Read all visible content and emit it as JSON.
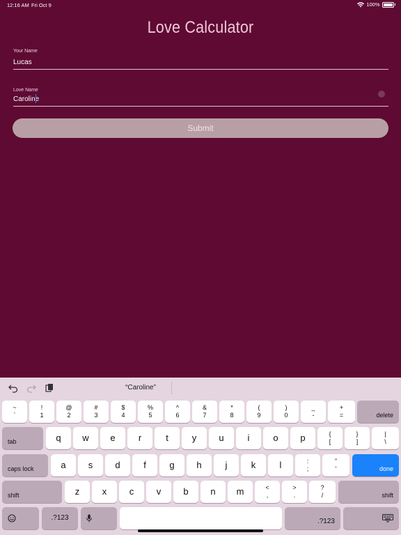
{
  "status_bar": {
    "time": "12:16 AM",
    "date": "Fri Oct 9",
    "battery": "100%"
  },
  "app": {
    "title": "Love Calculator",
    "your_name": {
      "label": "Your Name",
      "value": "Lucas"
    },
    "love_name": {
      "label": "Love Name",
      "value": "Caroline"
    },
    "submit_label": "Submit"
  },
  "keyboard": {
    "prediction": "“Caroline”",
    "number_row": [
      {
        "top": "~",
        "bottom": "`"
      },
      {
        "top": "!",
        "bottom": "1"
      },
      {
        "top": "@",
        "bottom": "2"
      },
      {
        "top": "#",
        "bottom": "3"
      },
      {
        "top": "$",
        "bottom": "4"
      },
      {
        "top": "%",
        "bottom": "5"
      },
      {
        "top": "^",
        "bottom": "6"
      },
      {
        "top": "&",
        "bottom": "7"
      },
      {
        "top": "*",
        "bottom": "8"
      },
      {
        "top": "(",
        "bottom": "9"
      },
      {
        "top": ")",
        "bottom": "0"
      },
      {
        "top": "_",
        "bottom": "-"
      },
      {
        "top": "+",
        "bottom": "="
      }
    ],
    "delete_label": "delete",
    "tab_label": "tab",
    "row_q": [
      "q",
      "w",
      "e",
      "r",
      "t",
      "y",
      "u",
      "i",
      "o",
      "p"
    ],
    "row_q_symbols": [
      {
        "top": "{",
        "bottom": "["
      },
      {
        "top": "}",
        "bottom": "]"
      },
      {
        "top": "|",
        "bottom": "\\"
      }
    ],
    "caps_label": "caps lock",
    "row_a": [
      "a",
      "s",
      "d",
      "f",
      "g",
      "h",
      "j",
      "k",
      "l"
    ],
    "row_a_symbols": [
      {
        "top": ":",
        "bottom": ";"
      },
      {
        "top": "”",
        "bottom": "’"
      }
    ],
    "done_label": "done",
    "shift_label": "shift",
    "row_z": [
      "z",
      "x",
      "c",
      "v",
      "b",
      "n",
      "m"
    ],
    "row_z_symbols": [
      {
        "top": "<",
        "bottom": ","
      },
      {
        "top": ">",
        "bottom": "."
      },
      {
        "top": "?",
        "bottom": "/"
      }
    ],
    "numbers_label": ".?123",
    "icons": {
      "undo": "undo-icon",
      "redo": "redo-icon",
      "paste": "paste-icon",
      "emoji": "emoji-icon",
      "mic": "microphone-icon",
      "hide": "keyboard-hide-icon"
    }
  }
}
